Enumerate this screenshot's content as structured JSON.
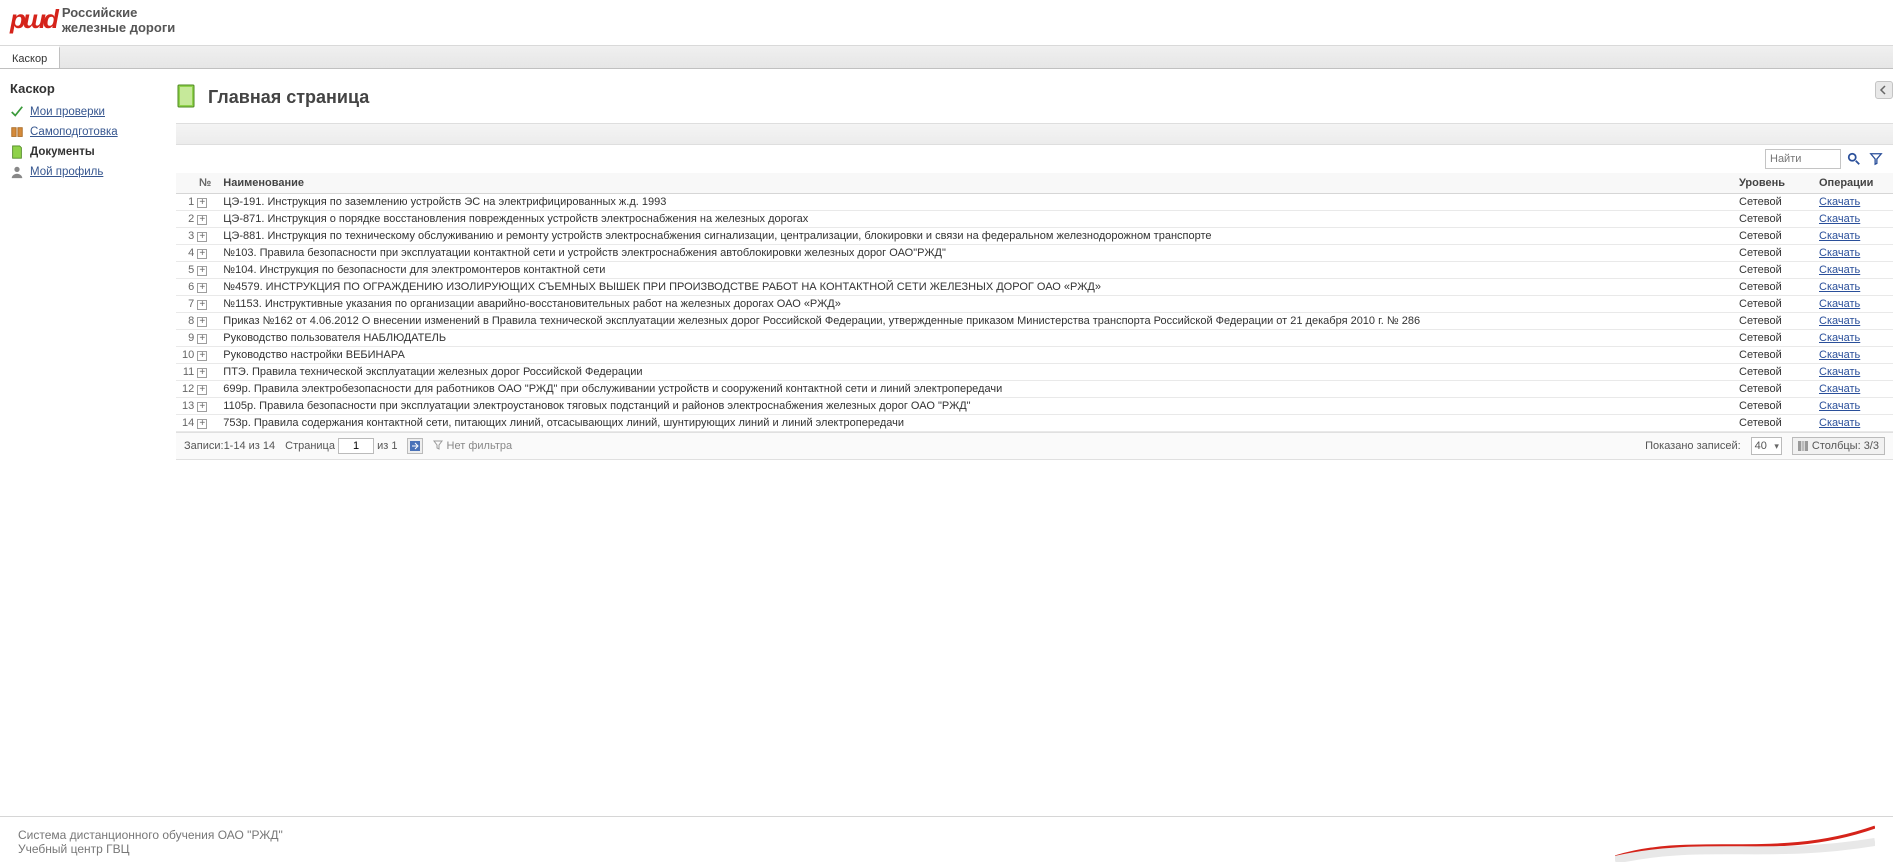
{
  "brand": {
    "mark": "pɯd",
    "line1": "Российские",
    "line2": "железные дороги"
  },
  "tabs": [
    {
      "label": "Каскор"
    }
  ],
  "sidebar": {
    "title": "Каскор",
    "items": [
      {
        "label": "Мои проверки"
      },
      {
        "label": "Самоподготовка"
      },
      {
        "label": "Документы"
      },
      {
        "label": "Мой профиль"
      }
    ],
    "active_index": 2
  },
  "page": {
    "title": "Главная страница"
  },
  "search": {
    "placeholder": "Найти"
  },
  "columns": {
    "num": "№",
    "name": "Наименование",
    "level": "Уровень",
    "ops": "Операции"
  },
  "level_label": "Сетевой",
  "download_label": "Скачать",
  "rows": [
    {
      "n": 1,
      "name": "ЦЭ-191. Инструкция по заземлению устройств ЭС на электрифицированных ж.д. 1993"
    },
    {
      "n": 2,
      "name": "ЦЭ-871. Инструкция о порядке восстановления поврежденных устройств электроснабжения на железных дорогах"
    },
    {
      "n": 3,
      "name": "ЦЭ-881. Инструкция по техническому обслуживанию и ремонту устройств электроснабжения сигнализации, централизации, блокировки и связи на федеральном железнодорожном транспорте"
    },
    {
      "n": 4,
      "name": "№103. Правила безопасности при эксплуатации контактной сети и устройств электроснабжения автоблокировки железных дорог ОАО\"РЖД\""
    },
    {
      "n": 5,
      "name": "№104. Инструкция по безопасности для электромонтеров контактной сети"
    },
    {
      "n": 6,
      "name": "№4579. ИНСТРУКЦИЯ ПО ОГРАЖДЕНИЮ ИЗОЛИРУЮЩИХ СЪЕМНЫХ ВЫШЕК ПРИ ПРОИЗВОДСТВЕ РАБОТ НА КОНТАКТНОЙ СЕТИ ЖЕЛЕЗНЫХ ДОРОГ ОАО «РЖД»"
    },
    {
      "n": 7,
      "name": "№1153. Инструктивные указания по организации аварийно-восстановительных работ на железных дорогах ОАО «РЖД»"
    },
    {
      "n": 8,
      "name": "Приказ №162 от 4.06.2012 О внесении изменений в Правила технической эксплуатации железных дорог Российской Федерации, утвержденные приказом Министерства транспорта Российской Федерации от 21 декабря 2010 г. № 286"
    },
    {
      "n": 9,
      "name": "Руководство пользователя НАБЛЮДАТЕЛЬ"
    },
    {
      "n": 10,
      "name": "Руководство настройки ВЕБИНАРА"
    },
    {
      "n": 11,
      "name": "ПТЭ. Правила технической эксплуатации железных дорог Российской Федерации"
    },
    {
      "n": 12,
      "name": "699р. Правила электробезопасности для работников ОАО \"РЖД\" при обслуживании устройств и сооружений контактной сети и линий электропередачи"
    },
    {
      "n": 13,
      "name": "1105р. Правила безопасности при эксплуатации электроустановок тяговых подстанций и районов электроснабжения железных дорог ОАО \"РЖД\""
    },
    {
      "n": 14,
      "name": "753р. Правила содержания контактной сети, питающих линий, отсасывающих линий, шунтирующих линий и линий электропередачи"
    }
  ],
  "footerbar": {
    "records": "Записи:1-14 из 14",
    "page_label": "Страница",
    "page_value": "1",
    "page_of": "из 1",
    "filter": "Нет фильтра",
    "shown_label": "Показано записей:",
    "shown_value": "40",
    "columns_label": "Столбцы: 3/3"
  },
  "site_footer": {
    "line1": "Система дистанционного обучения ОАО \"РЖД\"",
    "line2": "Учебный центр ГВЦ"
  }
}
